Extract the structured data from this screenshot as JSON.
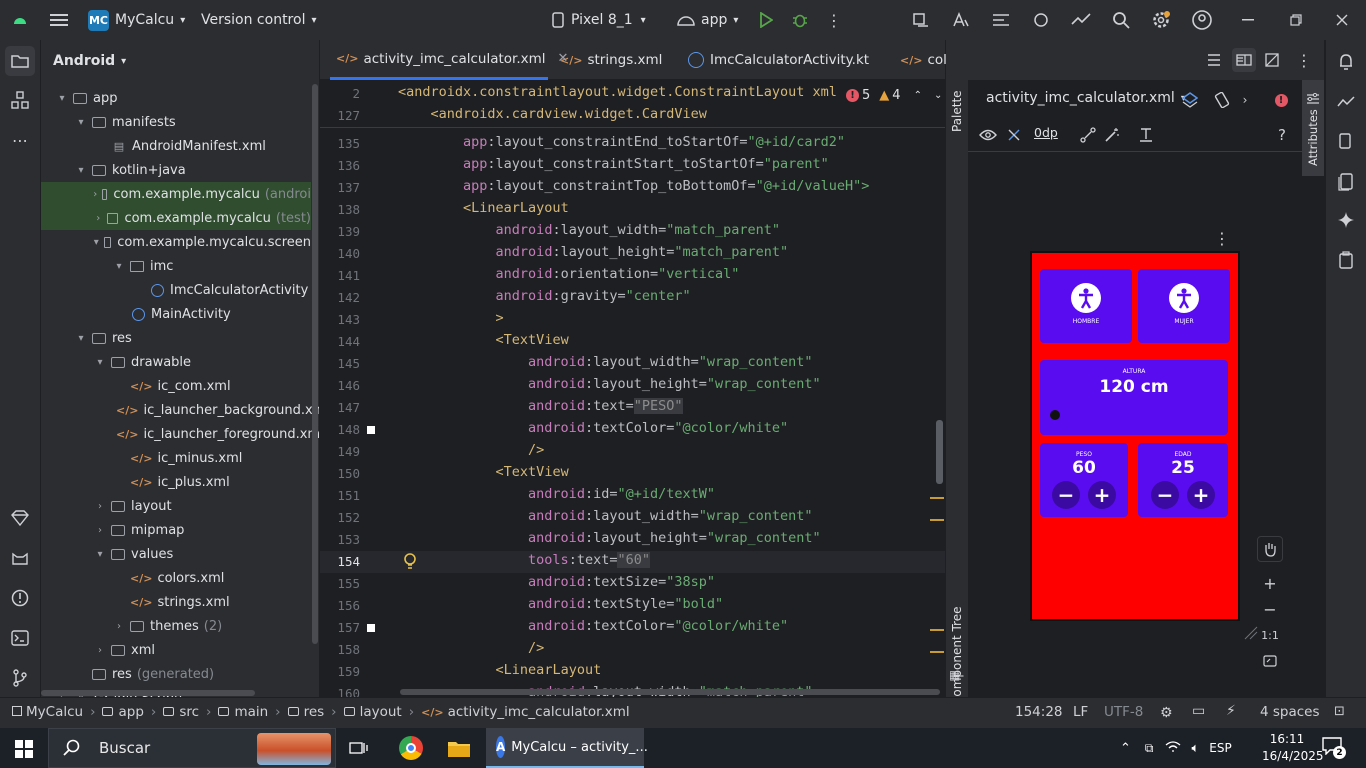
{
  "topbar": {
    "project_badge": "MC",
    "project_name": "MyCalcu",
    "vcs": "Version control",
    "device": "Pixel 8_1",
    "run_config": "app"
  },
  "project_panel": {
    "title": "Android",
    "items": [
      {
        "label": "app"
      },
      {
        "label": "manifests"
      },
      {
        "label": "AndroidManifest.xml"
      },
      {
        "label": "kotlin+java"
      },
      {
        "label": "com.example.mycalcu",
        "suffix": "(androi"
      },
      {
        "label": "com.example.mycalcu",
        "suffix": "(test)"
      },
      {
        "label": "com.example.mycalcu.screen"
      },
      {
        "label": "imc"
      },
      {
        "label": "ImcCalculatorActivity"
      },
      {
        "label": "MainActivity"
      },
      {
        "label": "res"
      },
      {
        "label": "drawable"
      },
      {
        "label": "ic_com.xml"
      },
      {
        "label": "ic_launcher_background.xm"
      },
      {
        "label": "ic_launcher_foreground.xm"
      },
      {
        "label": "ic_minus.xml"
      },
      {
        "label": "ic_plus.xml"
      },
      {
        "label": "layout"
      },
      {
        "label": "mipmap"
      },
      {
        "label": "values"
      },
      {
        "label": "colors.xml"
      },
      {
        "label": "strings.xml"
      },
      {
        "label": "themes",
        "suffix": "(2)"
      },
      {
        "label": "xml"
      },
      {
        "label": "res",
        "suffix": "(generated)"
      },
      {
        "label": "Gradle Scripts"
      }
    ]
  },
  "editor": {
    "tabs": [
      {
        "label": "activity_imc_calculator.xml"
      },
      {
        "label": "strings.xml"
      },
      {
        "label": "ImcCalculatorActivity.kt"
      },
      {
        "label": "colors.xml"
      }
    ],
    "errors": "5",
    "warnings": "4",
    "sticky": [
      {
        "ln": "2",
        "text": "<androidx.constraintlayout.widget.ConstraintLayout xml"
      },
      {
        "ln": "127",
        "text": "    <androidx.cardview.widget.CardView"
      }
    ],
    "lines": [
      {
        "ln": "135",
        "indent": "        ",
        "ns": "app",
        "attr": ":layout_constraintEnd_toStartOf=",
        "val": "\"@+id/card2\""
      },
      {
        "ln": "136",
        "indent": "        ",
        "ns": "app",
        "attr": ":layout_constraintStart_toStartOf=",
        "val": "\"parent\""
      },
      {
        "ln": "137",
        "indent": "        ",
        "ns": "app",
        "attr": ":layout_constraintTop_toBottomOf=",
        "val": "\"@+id/valueH\">"
      },
      {
        "ln": "138",
        "indent": "        ",
        "tag": "<LinearLayout"
      },
      {
        "ln": "139",
        "indent": "            ",
        "ns": "android",
        "attr": ":layout_width=",
        "val": "\"match_parent\""
      },
      {
        "ln": "140",
        "indent": "            ",
        "ns": "android",
        "attr": ":layout_height=",
        "val": "\"match_parent\""
      },
      {
        "ln": "141",
        "indent": "            ",
        "ns": "android",
        "attr": ":orientation=",
        "val": "\"vertical\""
      },
      {
        "ln": "142",
        "indent": "            ",
        "ns": "android",
        "attr": ":gravity=",
        "val": "\"center\""
      },
      {
        "ln": "143",
        "indent": "            ",
        "tag": ">"
      },
      {
        "ln": "144",
        "indent": "            ",
        "tag": "<TextView"
      },
      {
        "ln": "145",
        "indent": "                ",
        "ns": "android",
        "attr": ":layout_width=",
        "val": "\"wrap_content\""
      },
      {
        "ln": "146",
        "indent": "                ",
        "ns": "android",
        "attr": ":layout_height=",
        "val": "\"wrap_content\""
      },
      {
        "ln": "147",
        "indent": "                ",
        "ns": "android",
        "attr": ":text=",
        "val": "\"PESO\""
      },
      {
        "ln": "148",
        "indent": "                ",
        "ns": "android",
        "attr": ":textColor=",
        "val": "\"@color/white\""
      },
      {
        "ln": "149",
        "indent": "                ",
        "tag": "/>"
      },
      {
        "ln": "150",
        "indent": "            ",
        "tag": "<TextView"
      },
      {
        "ln": "151",
        "indent": "                ",
        "ns": "android",
        "attr": ":id=",
        "val": "\"@+id/textW\""
      },
      {
        "ln": "152",
        "indent": "                ",
        "ns": "android",
        "attr": ":layout_width=",
        "val": "\"wrap_content\""
      },
      {
        "ln": "153",
        "indent": "                ",
        "ns": "android",
        "attr": ":layout_height=",
        "val": "\"wrap_content\""
      },
      {
        "ln": "154",
        "indent": "                ",
        "ns": "tools",
        "attr": ":text=",
        "val": "\"60\""
      },
      {
        "ln": "155",
        "indent": "                ",
        "ns": "android",
        "attr": ":textSize=",
        "val": "\"38sp\""
      },
      {
        "ln": "156",
        "indent": "                ",
        "ns": "android",
        "attr": ":textStyle=",
        "val": "\"bold\""
      },
      {
        "ln": "157",
        "indent": "                ",
        "ns": "android",
        "attr": ":textColor=",
        "val": "\"@color/white\""
      },
      {
        "ln": "158",
        "indent": "                ",
        "tag": "/>"
      },
      {
        "ln": "159",
        "indent": "            ",
        "tag": "<LinearLayout"
      },
      {
        "ln": "160",
        "indent": "                ",
        "ns": "android",
        "attr": ":layout_width=",
        "val": "\"match_parent\""
      }
    ]
  },
  "design": {
    "file": "activity_imc_calculator.xml",
    "margin": "0dp",
    "palette_label": "Palette",
    "tree_label": "Component Tree",
    "attributes_label": "Attributes",
    "zoom_ratio": "1:1",
    "preview": {
      "hombre": "HOMBRE",
      "mujer": "MUJER",
      "altura_label": "ALTURA",
      "altura_value": "120 cm",
      "peso_label": "PESO",
      "peso_value": "60",
      "edad_label": "EDAD",
      "edad_value": "25"
    }
  },
  "statusbar": {
    "crumbs": [
      "MyCalcu",
      "app",
      "src",
      "main",
      "res",
      "layout",
      "activity_imc_calculator.xml"
    ],
    "position": "154:28",
    "line_sep": "LF",
    "encoding": "UTF-8",
    "indent": "4 spaces"
  },
  "taskbar": {
    "search": "Buscar",
    "active_window": "MyCalcu – activity_...",
    "lang": "ESP",
    "time": "16:11",
    "date": "16/4/2025",
    "notifications": "2"
  },
  "colors": {
    "accent": "#3574f0",
    "preview_bg": "#ff0000",
    "card": "#5a0cf0"
  }
}
